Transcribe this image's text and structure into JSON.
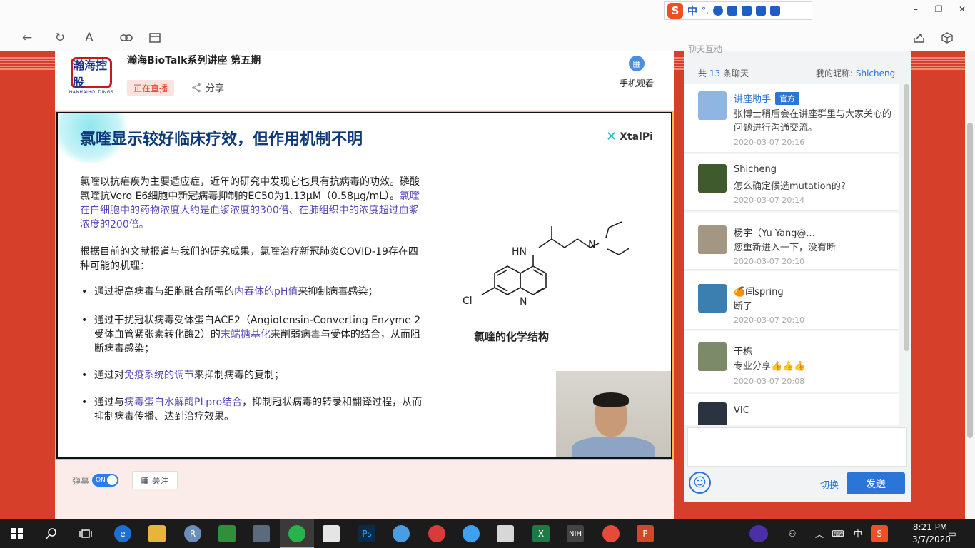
{
  "ime": {
    "label": "中",
    "punct": "°,"
  },
  "window_controls": {
    "minimize": "–",
    "restore": "❐",
    "close": "✕"
  },
  "browser": {
    "back": "←",
    "reload": "↻",
    "reader": "A"
  },
  "header": {
    "org_logo_text": "瀚海控股",
    "org_logo_sub": "HANHAIHOLDINGS",
    "title": "瀚海BioTalk系列讲座 第五期",
    "live_badge": "正在直播",
    "share_label": "分享",
    "mobile_label": "手机观看"
  },
  "slide": {
    "title": "氯喹显示较好临床疗效，但作用机制不明",
    "brand": "XtalPi",
    "para1_plain": "氯喹以抗疟疾为主要适应症，近年的研究中发现它也具有抗病毒的功效。磷酸氯喹抗Vero  E6细胞中新冠病毒抑制的EC50为1.13μM（0.58μg/mL）。",
    "para1_highlight": "氯喹在白细胞中的药物浓度大约是血浆浓度的300倍、在肺组织中的浓度超过血浆浓度的200倍。",
    "para2": "根据目前的文献报道与我们的研究成果，氯喹治疗新冠肺炎COVID-19存在四种可能的机理：",
    "bullets": [
      {
        "pre": "通过提高病毒与细胞融合所需的",
        "hl": "内吞体的pH值",
        "post": "来抑制病毒感染；"
      },
      {
        "pre": "通过干扰冠状病毒受体蛋白ACE2（Angiotensin-Converting Enzyme 2 受体血管紧张素转化酶2）的",
        "hl": "末端糖基化",
        "post": "来削弱病毒与受体的结合，从而阻断病毒感染；"
      },
      {
        "pre": "通过对",
        "hl": "免疫系统的调节",
        "post": "来抑制病毒的复制；"
      },
      {
        "pre": "通过与",
        "hl": "病毒蛋白水解酶PLpro结合",
        "post": "，抑制冠状病毒的转录和翻译过程，从而抑制病毒传播、达到治疗效果。"
      }
    ],
    "chem_caption": "氯喹的化学结构",
    "chem_labels": {
      "hn": "HN",
      "n_amine": "N",
      "cl": "Cl",
      "n_ring": "N"
    }
  },
  "controls": {
    "danmu_label": "弹幕",
    "toggle_label": "ON",
    "follow_label": "关注"
  },
  "chat": {
    "header_partial": "聊天互动",
    "count_prefix": "共",
    "count": "13",
    "count_suffix": "条聊天",
    "nick_label": "我的昵称:",
    "nick_value": "Shicheng",
    "messages": [
      {
        "name": "讲座助手",
        "tag": "官方",
        "text": "张博士稍后会在讲座群里与大家关心的问题进行沟通交流。",
        "time": "2020-03-07 20:16"
      },
      {
        "name": "Shicheng",
        "tag": "",
        "text": "怎么确定候选mutation的?",
        "time": "2020-03-07 20:14"
      },
      {
        "name": "杨宇（Yu Yang@...",
        "tag": "",
        "text": "您重新进入一下，没有断",
        "time": "2020-03-07 20:10"
      },
      {
        "name": "🍊闫spring",
        "tag": "",
        "text": "断了",
        "time": "2020-03-07 20:10"
      },
      {
        "name": "于栋",
        "tag": "",
        "text": "专业分享👍👍👍",
        "time": "2020-03-07 20:08"
      },
      {
        "name": "VIC",
        "tag": "",
        "text": "",
        "time": ""
      }
    ],
    "emoji_glyph": "☺",
    "switch_label": "切换",
    "send_label": "发送"
  },
  "taskbar": {
    "ime_tray": "中",
    "time": "8:21 PM",
    "date": "3/7/2020"
  }
}
